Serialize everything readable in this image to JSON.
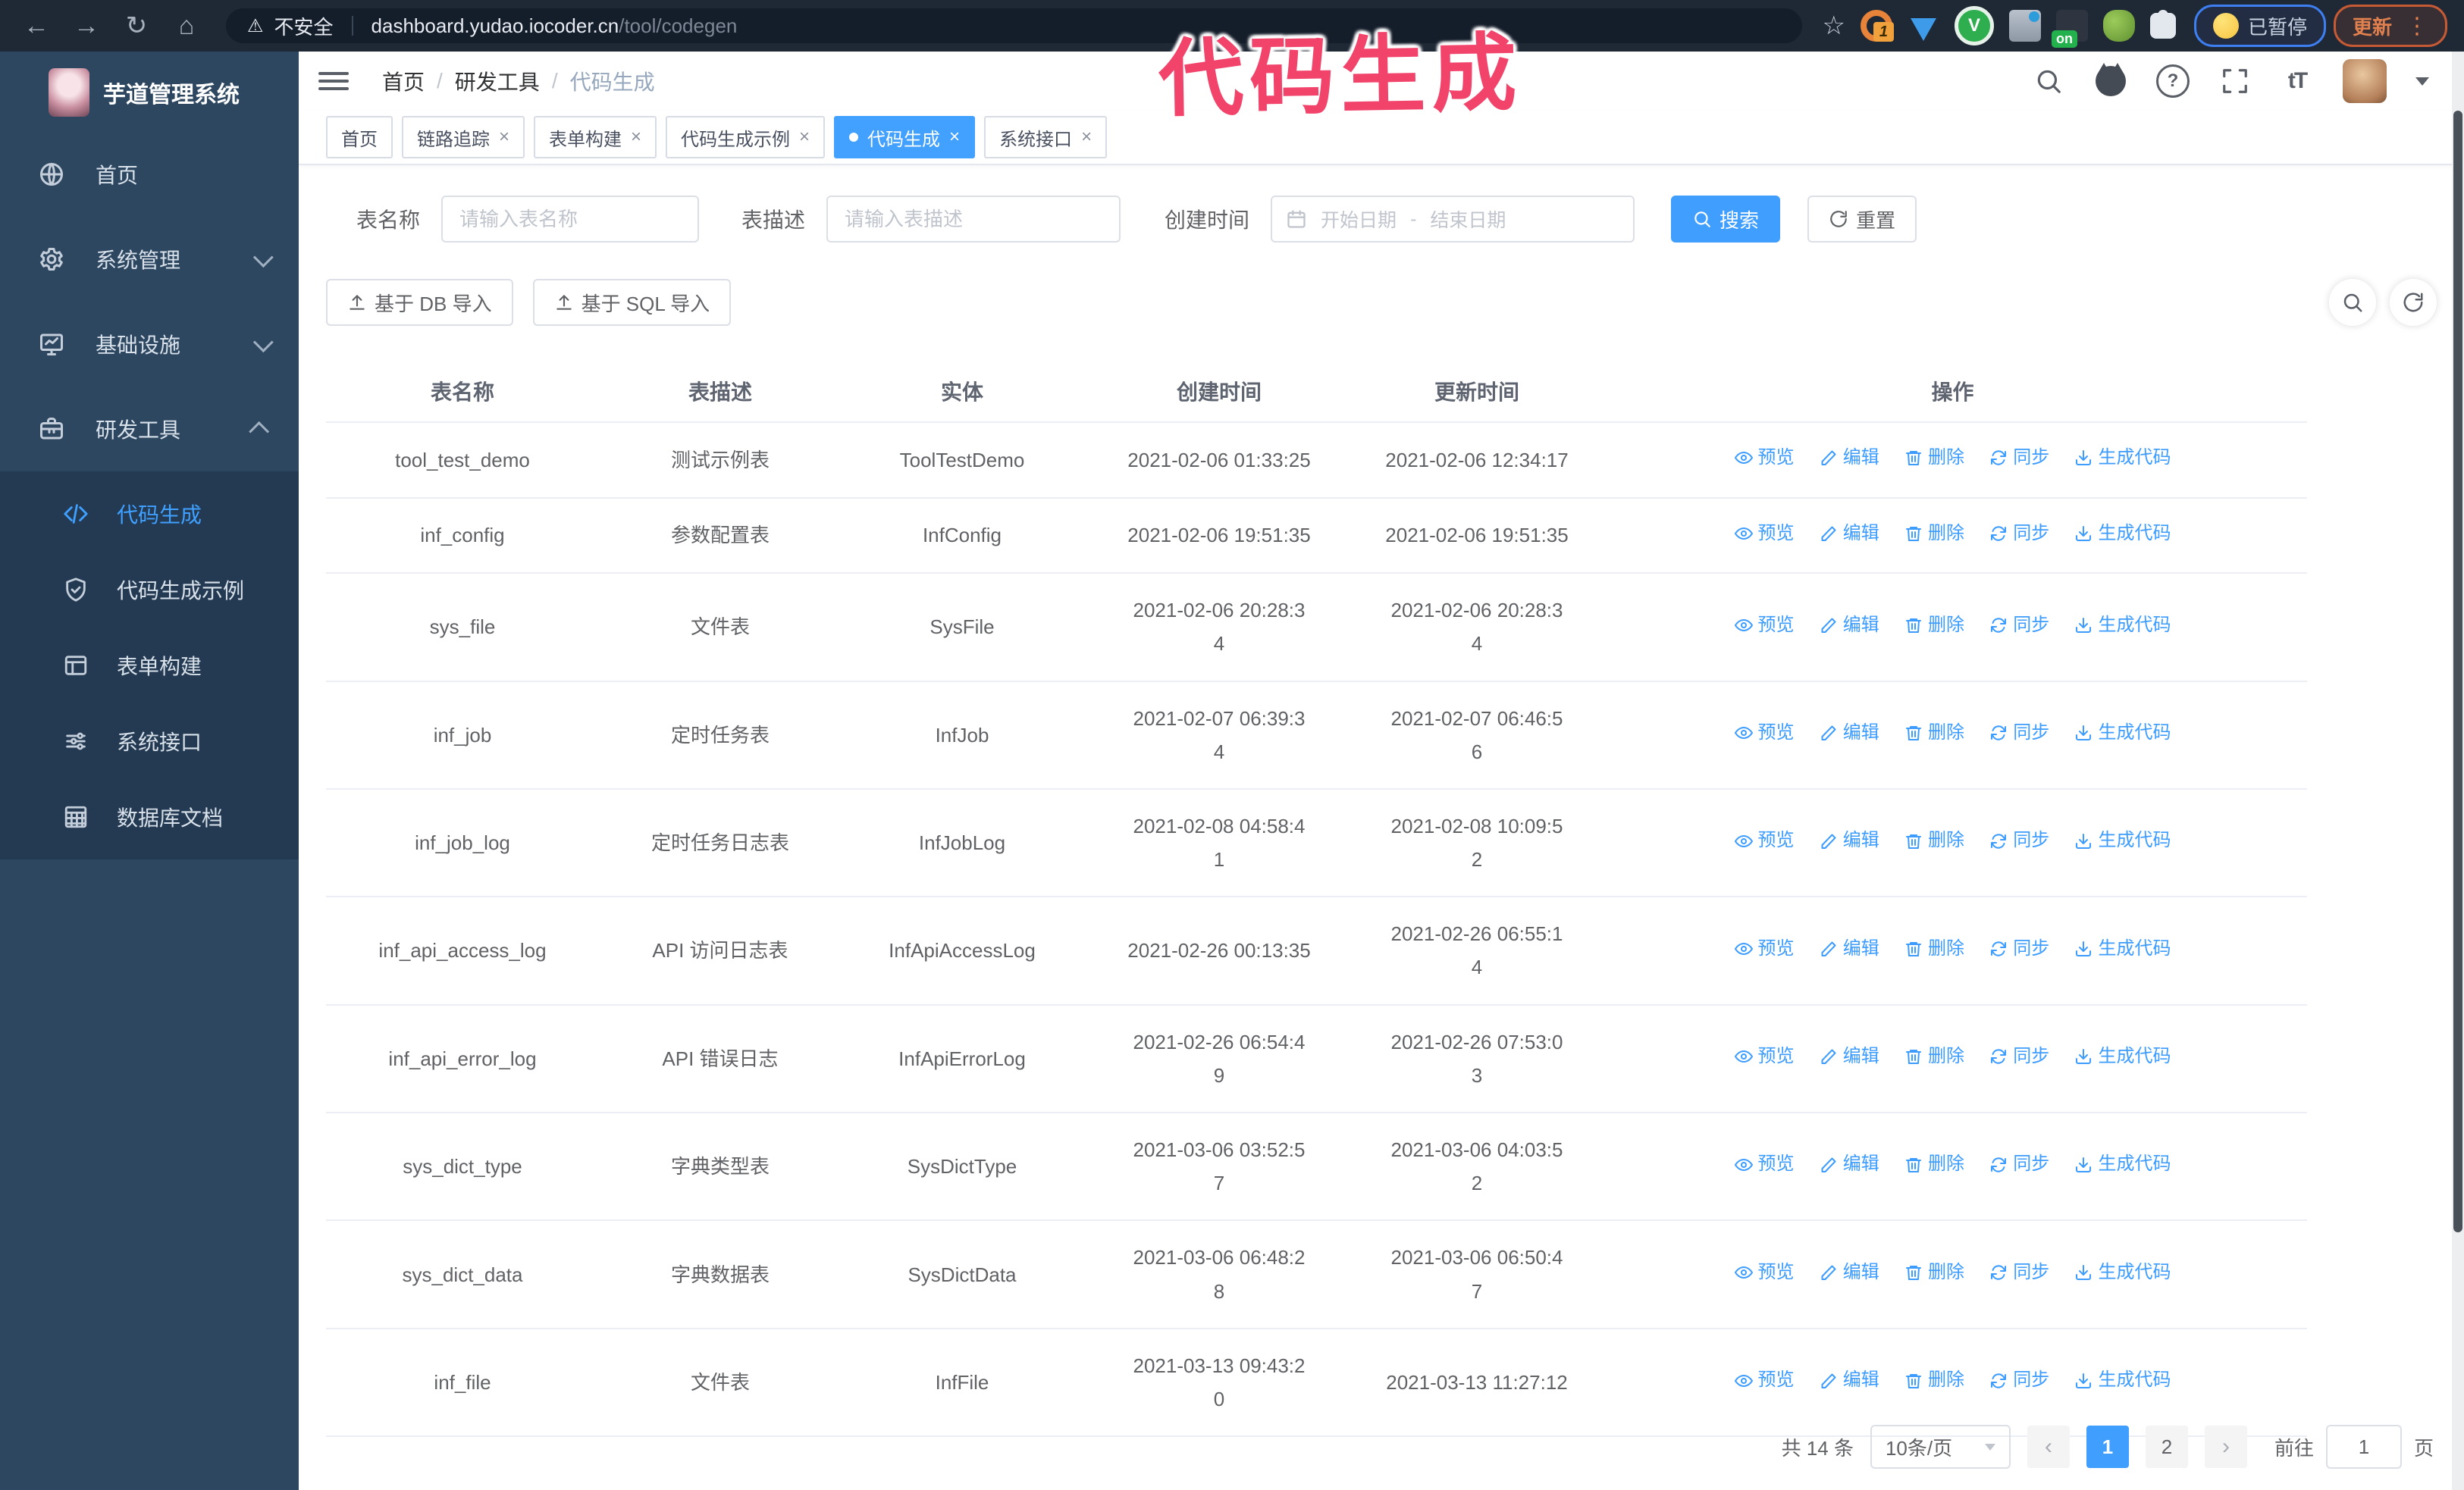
{
  "browser": {
    "security_label": "不安全",
    "url_host": "dashboard.yudao.iocoder.cn",
    "url_path": "/tool/codegen",
    "ext_badge": "1",
    "ext_on": "on",
    "paused_label": "已暂停",
    "update_label": "更新"
  },
  "annotation": "代码生成",
  "sidebar": {
    "title": "芋道管理系统",
    "items": [
      {
        "label": "首页"
      },
      {
        "label": "系统管理"
      },
      {
        "label": "基础设施"
      },
      {
        "label": "研发工具"
      }
    ],
    "sub_items": [
      {
        "label": "代码生成"
      },
      {
        "label": "代码生成示例"
      },
      {
        "label": "表单构建"
      },
      {
        "label": "系统接口"
      },
      {
        "label": "数据库文档"
      }
    ]
  },
  "header": {
    "breadcrumb": [
      "首页",
      "研发工具",
      "代码生成"
    ]
  },
  "tabs": [
    {
      "label": "首页"
    },
    {
      "label": "链路追踪"
    },
    {
      "label": "表单构建"
    },
    {
      "label": "代码生成示例"
    },
    {
      "label": "代码生成"
    },
    {
      "label": "系统接口"
    }
  ],
  "search": {
    "name_label": "表名称",
    "name_placeholder": "请输入表名称",
    "desc_label": "表描述",
    "desc_placeholder": "请输入表描述",
    "time_label": "创建时间",
    "start_placeholder": "开始日期",
    "range_separator": "-",
    "end_placeholder": "结束日期",
    "search_label": "搜索",
    "reset_label": "重置"
  },
  "toolbar": {
    "db_import_label": "基于 DB 导入",
    "sql_import_label": "基于 SQL 导入"
  },
  "table": {
    "headers": [
      "表名称",
      "表描述",
      "实体",
      "创建时间",
      "更新时间",
      "操作"
    ],
    "actions": [
      "预览",
      "编辑",
      "删除",
      "同步",
      "生成代码"
    ],
    "rows": [
      {
        "name": "tool_test_demo",
        "desc": "测试示例表",
        "entity": "ToolTestDemo",
        "create": [
          "2021-02-06 01:33:25"
        ],
        "update": [
          "2021-02-06 12:34:17"
        ]
      },
      {
        "name": "inf_config",
        "desc": "参数配置表",
        "entity": "InfConfig",
        "create": [
          "2021-02-06 19:51:35"
        ],
        "update": [
          "2021-02-06 19:51:35"
        ]
      },
      {
        "name": "sys_file",
        "desc": "文件表",
        "entity": "SysFile",
        "create": [
          "2021-02-06 20:28:3",
          "4"
        ],
        "update": [
          "2021-02-06 20:28:3",
          "4"
        ]
      },
      {
        "name": "inf_job",
        "desc": "定时任务表",
        "entity": "InfJob",
        "create": [
          "2021-02-07 06:39:3",
          "4"
        ],
        "update": [
          "2021-02-07 06:46:5",
          "6"
        ]
      },
      {
        "name": "inf_job_log",
        "desc": "定时任务日志表",
        "entity": "InfJobLog",
        "create": [
          "2021-02-08 04:58:4",
          "1"
        ],
        "update": [
          "2021-02-08 10:09:5",
          "2"
        ]
      },
      {
        "name": "inf_api_access_log",
        "desc": "API 访问日志表",
        "entity": "InfApiAccessLog",
        "create": [
          "2021-02-26 00:13:35"
        ],
        "update": [
          "2021-02-26 06:55:1",
          "4"
        ]
      },
      {
        "name": "inf_api_error_log",
        "desc": "API 错误日志",
        "entity": "InfApiErrorLog",
        "create": [
          "2021-02-26 06:54:4",
          "9"
        ],
        "update": [
          "2021-02-26 07:53:0",
          "3"
        ]
      },
      {
        "name": "sys_dict_type",
        "desc": "字典类型表",
        "entity": "SysDictType",
        "create": [
          "2021-03-06 03:52:5",
          "7"
        ],
        "update": [
          "2021-03-06 04:03:5",
          "2"
        ]
      },
      {
        "name": "sys_dict_data",
        "desc": "字典数据表",
        "entity": "SysDictData",
        "create": [
          "2021-03-06 06:48:2",
          "8"
        ],
        "update": [
          "2021-03-06 06:50:4",
          "7"
        ]
      },
      {
        "name": "inf_file",
        "desc": "文件表",
        "entity": "InfFile",
        "create": [
          "2021-03-13 09:43:2",
          "0"
        ],
        "update": [
          "2021-03-13 11:27:12"
        ]
      }
    ]
  },
  "pagination": {
    "total": "共 14 条",
    "page_size": "10条/页",
    "pages": [
      "1",
      "2"
    ],
    "goto_label": "前往",
    "goto_value": "1",
    "unit_label": "页"
  },
  "colors": {
    "primary": "#409EFF",
    "annotation_pink": "#F2436B",
    "sidebar_bg": "#2E4761",
    "submenu_bg": "#233A52"
  }
}
